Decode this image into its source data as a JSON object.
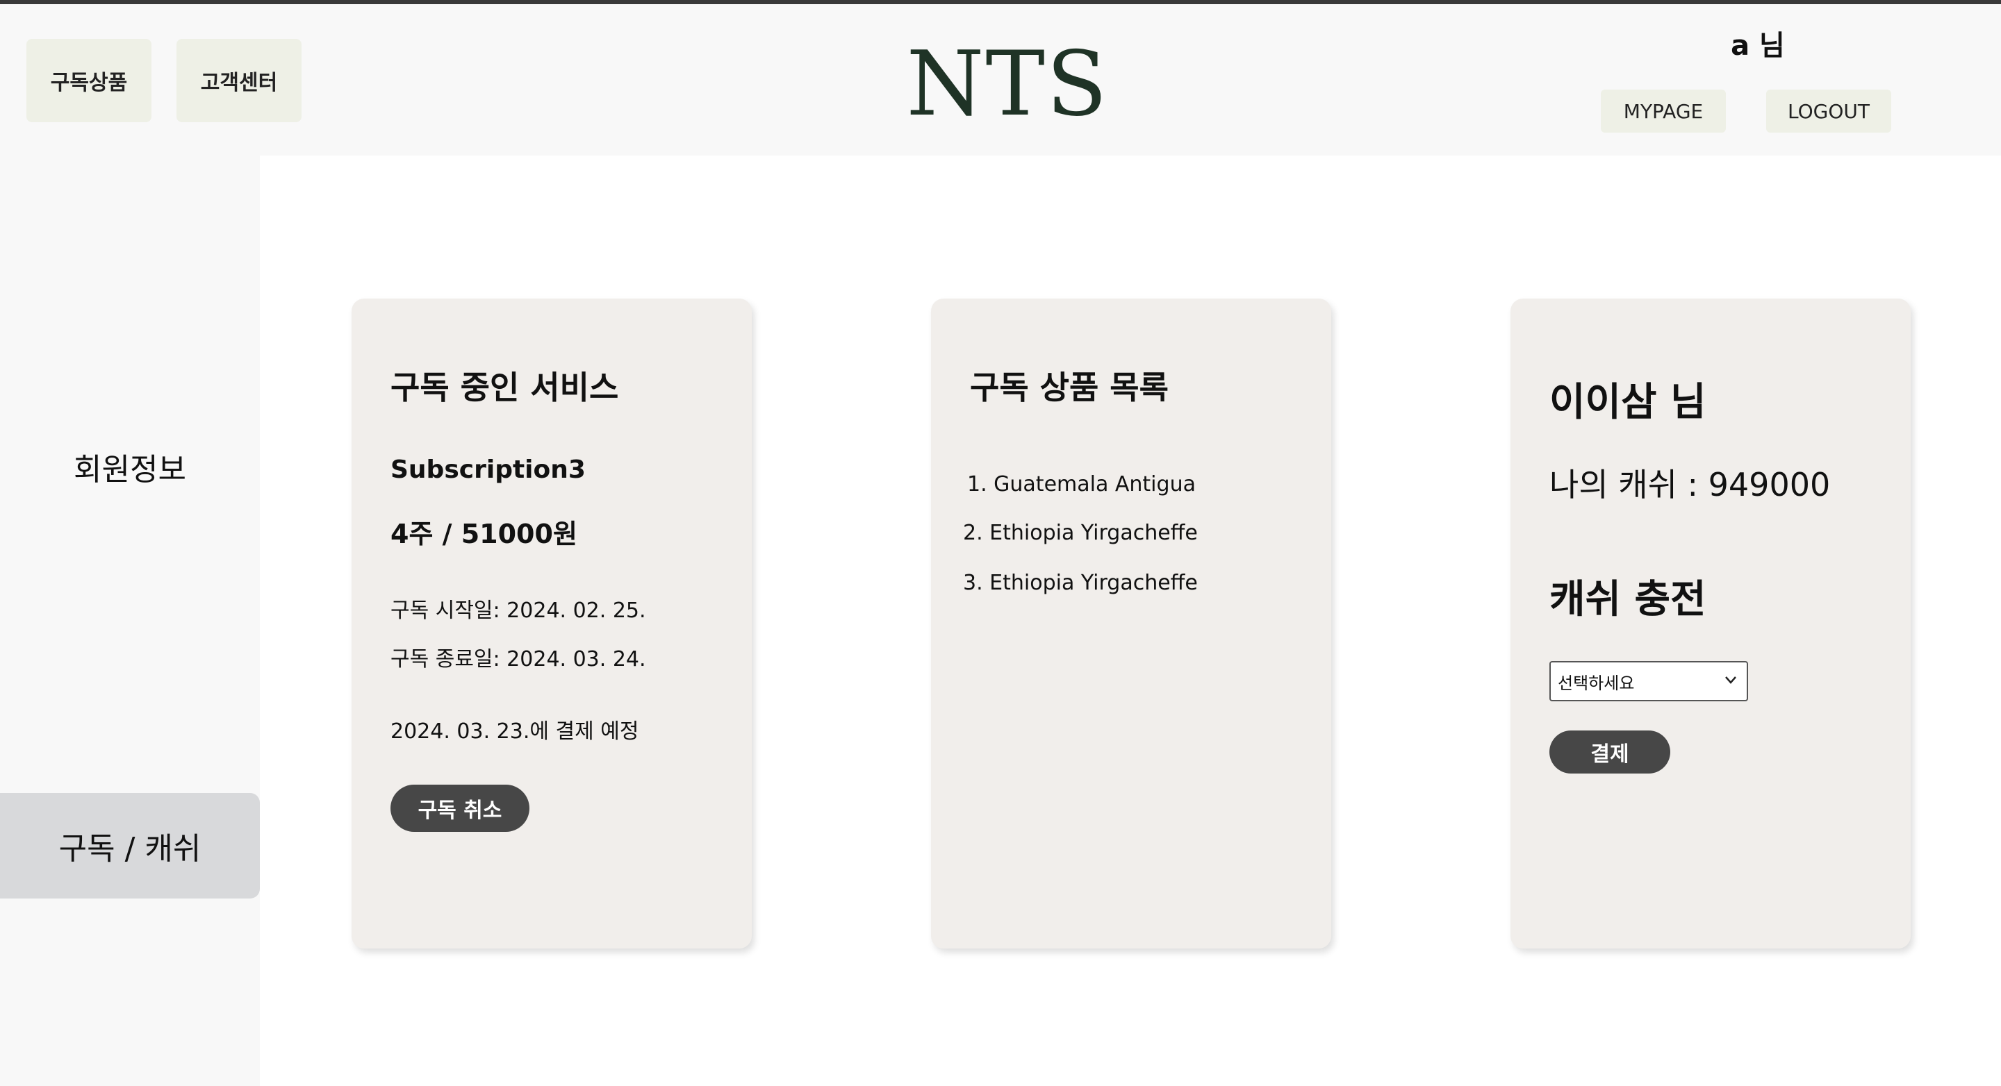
{
  "header": {
    "nav": [
      "구독상품",
      "고객센터"
    ],
    "logo": "NTS",
    "user_greeting": "a 님",
    "mypage_label": "MYPAGE",
    "logout_label": "LOGOUT"
  },
  "sidebar": {
    "items": [
      {
        "label": "회원정보",
        "active": false
      },
      {
        "label": "구독 / 캐쉬",
        "active": true
      }
    ]
  },
  "subscription_card": {
    "title": "구독 중인 서비스",
    "plan_name": "Subscription3",
    "plan_price": "4주 / 51000원",
    "start_date": "구독 시작일: 2024. 02. 25.",
    "end_date": "구독 종료일: 2024. 03. 24.",
    "next_payment": "2024. 03. 23.에 결제 예정",
    "cancel_label": "구독 취소"
  },
  "products_card": {
    "title": "구독 상품 목록",
    "items": [
      "1.  Guatemala Antigua",
      "2. Ethiopia Yirgacheffe",
      "3. Ethiopia Yirgacheffe"
    ]
  },
  "cash_card": {
    "user_name": "이이삼 님",
    "cash_balance": "나의 캐쉬 : 949000",
    "recharge_title": "캐쉬 충전",
    "select_placeholder": "선택하세요",
    "pay_label": "결제"
  },
  "colors": {
    "topline": "#3a3a3a",
    "nav_button_bg": "#eef0e6",
    "logo": "#1f3326",
    "card_bg": "#f1eeeb",
    "pill_button": "#474747",
    "sidebar_active": "#d8d9db"
  },
  "icons": {
    "select_arrow": "chevron-down-icon"
  }
}
